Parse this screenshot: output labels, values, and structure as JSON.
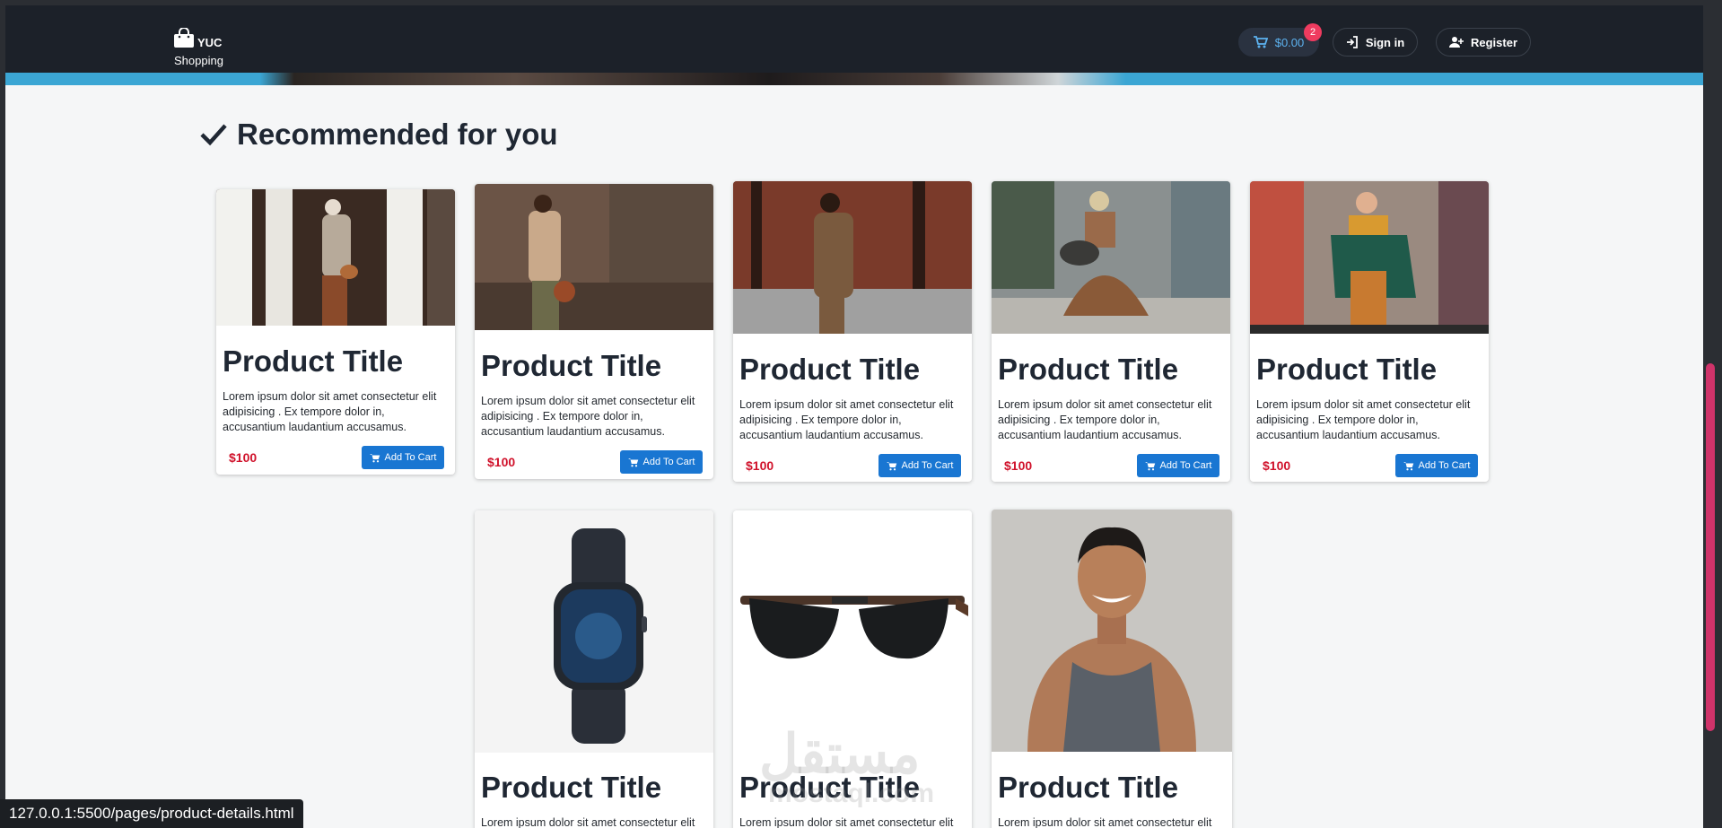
{
  "header": {
    "brand_line1": "YUC",
    "brand_line2": "Shopping",
    "cart_total": "$0.00",
    "cart_count": "2",
    "signin_label": "Sign in",
    "register_label": "Register"
  },
  "section": {
    "title": "Recommended for you"
  },
  "products": [
    {
      "title": "Product Title",
      "description": "Lorem ipsum dolor sit amet consectetur elit adipisicing . Ex tempore dolor in, accusantium laudantium accusamus.",
      "price": "$100",
      "button": "Add To Cart"
    },
    {
      "title": "Product Title",
      "description": "Lorem ipsum dolor sit amet consectetur elit adipisicing . Ex tempore dolor in, accusantium laudantium accusamus.",
      "price": "$100",
      "button": "Add To Cart"
    },
    {
      "title": "Product Title",
      "description": "Lorem ipsum dolor sit amet consectetur elit adipisicing . Ex tempore dolor in, accusantium laudantium accusamus.",
      "price": "$100",
      "button": "Add To Cart"
    },
    {
      "title": "Product Title",
      "description": "Lorem ipsum dolor sit amet consectetur elit adipisicing . Ex tempore dolor in, accusantium laudantium accusamus.",
      "price": "$100",
      "button": "Add To Cart"
    },
    {
      "title": "Product Title",
      "description": "Lorem ipsum dolor sit amet consectetur elit adipisicing . Ex tempore dolor in, accusantium laudantium accusamus.",
      "price": "$100",
      "button": "Add To Cart"
    },
    {
      "title": "Product Title",
      "description": "Lorem ipsum dolor sit amet consectetur elit"
    },
    {
      "title": "Product Title",
      "description": "Lorem ipsum dolor sit amet consectetur elit"
    },
    {
      "title": "Product Title",
      "description": "Lorem ipsum dolor sit amet consectetur elit"
    }
  ],
  "watermark": {
    "arabic": "مستقل",
    "latin": "mostaql.com"
  },
  "status_bar": {
    "url": "127.0.0.1:5500/pages/product-details.html"
  },
  "colors": {
    "accent": "#1976d2",
    "price": "#d0122b",
    "badge": "#ef3b5f",
    "header_bg": "#1c2129"
  }
}
